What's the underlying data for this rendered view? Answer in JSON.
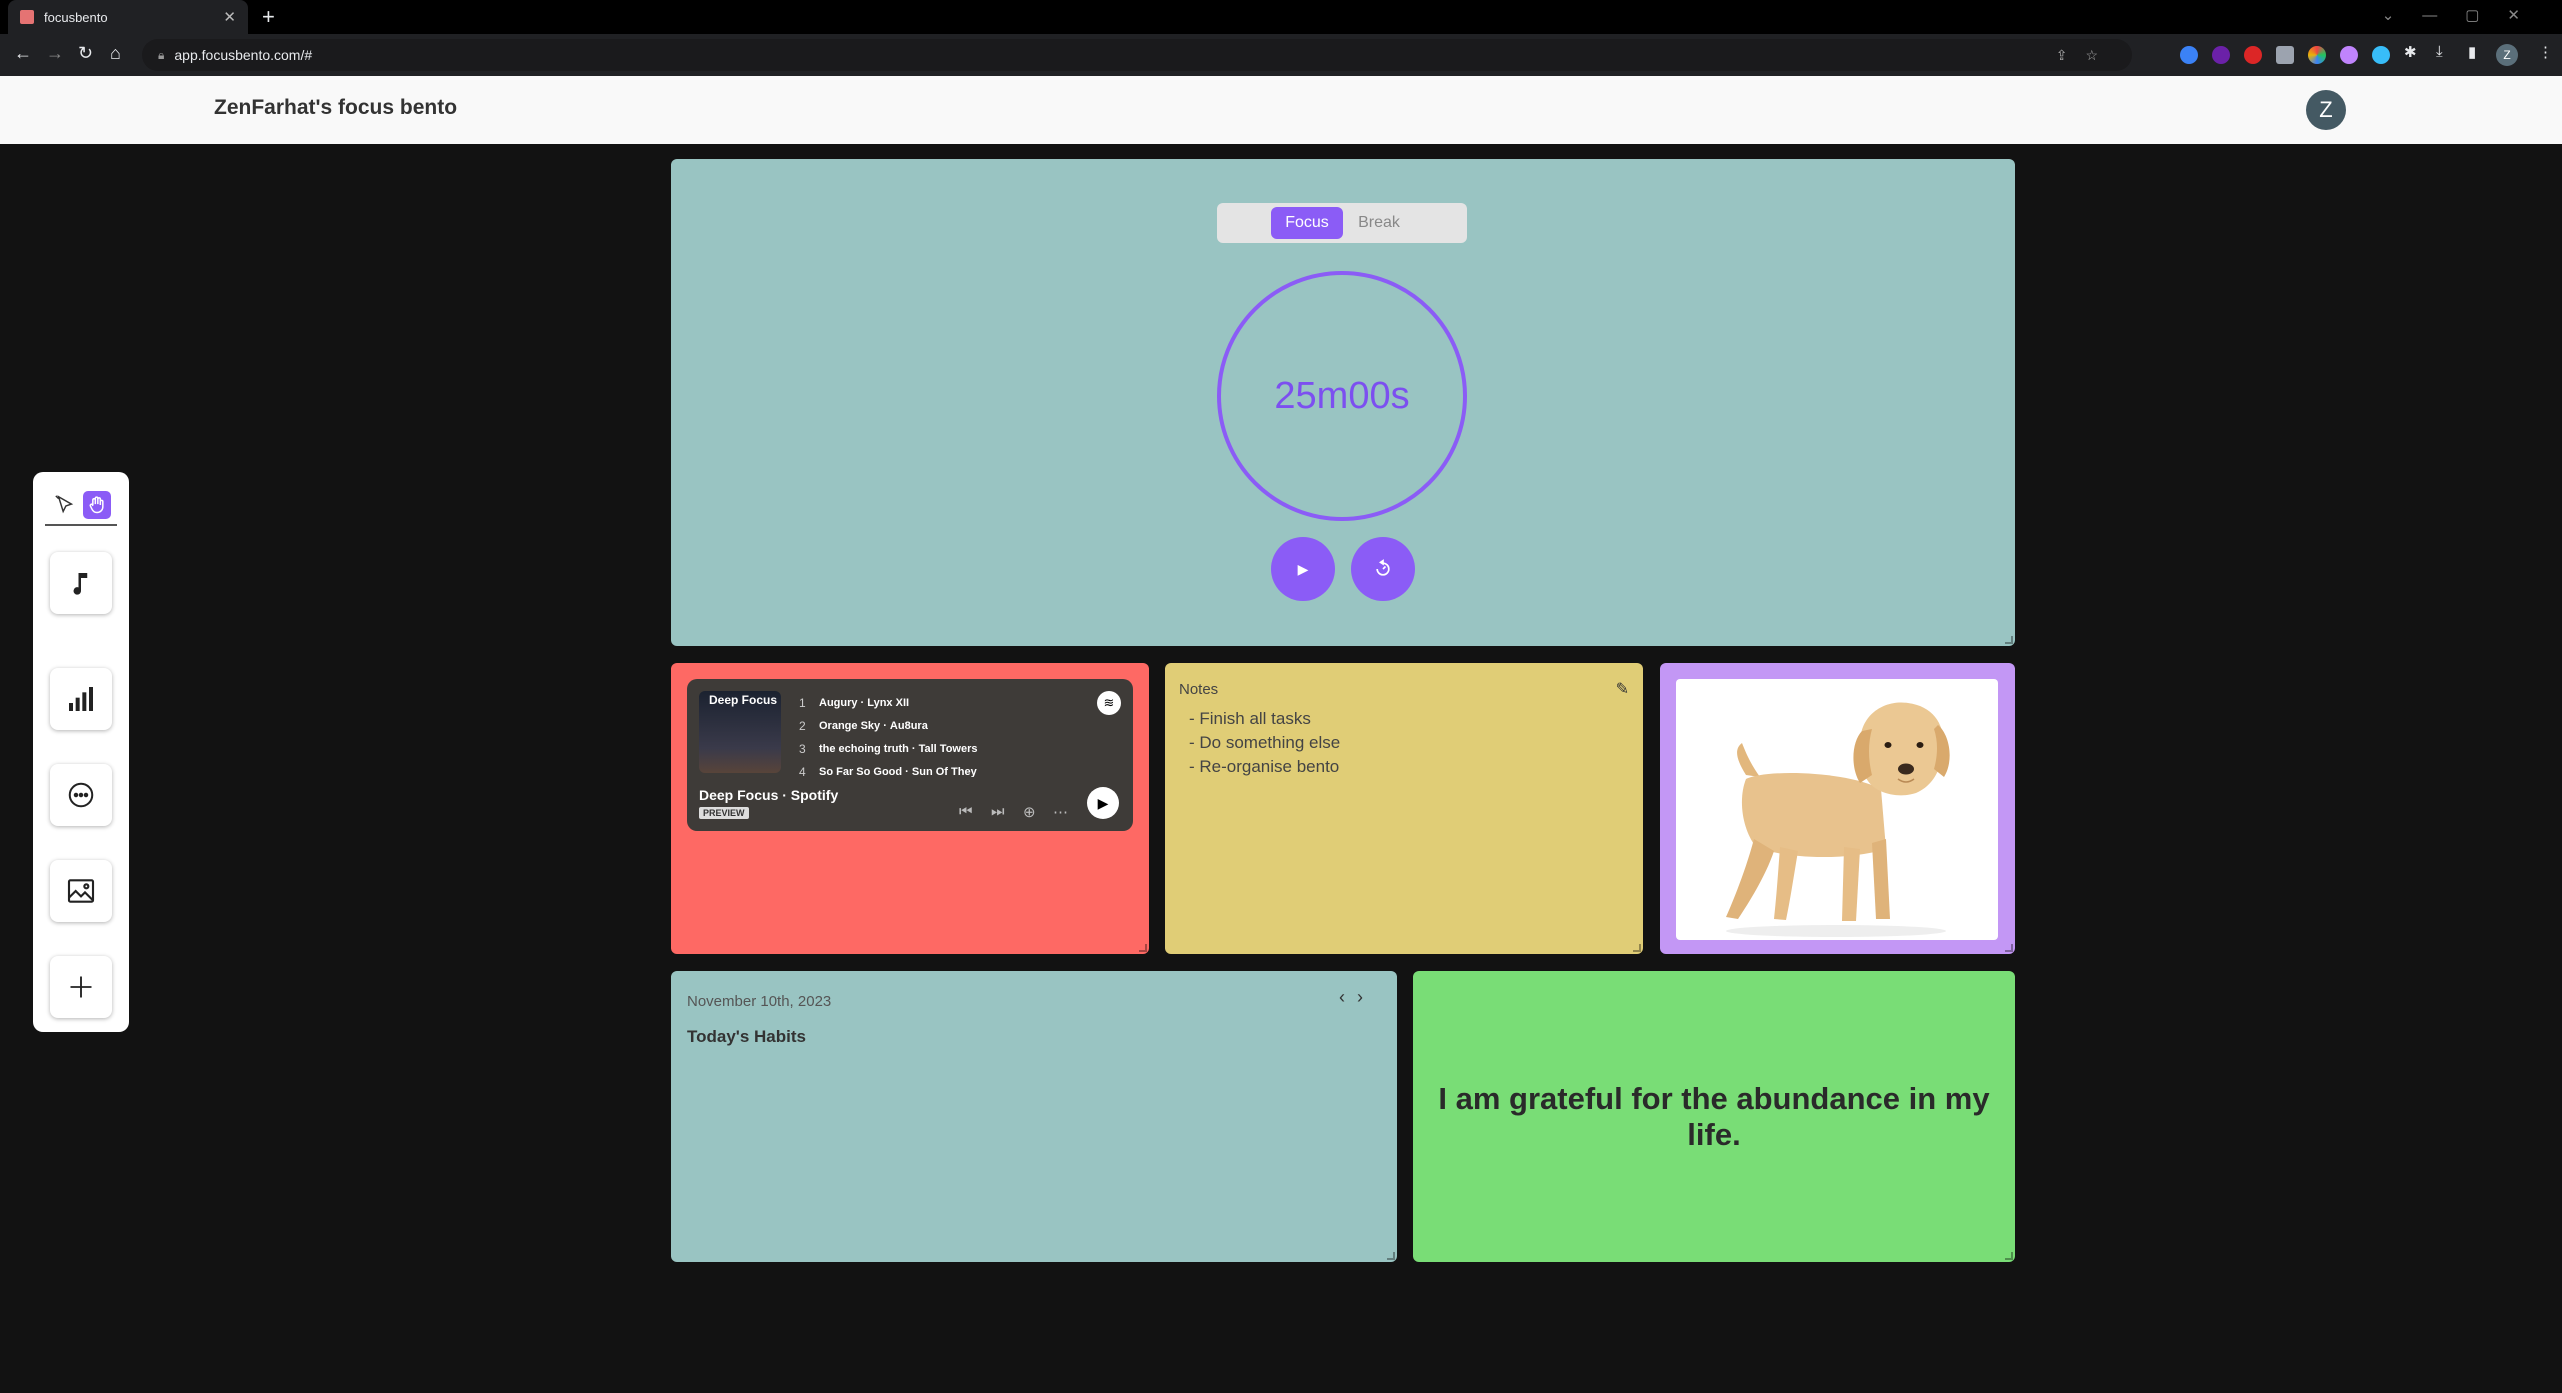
{
  "browser": {
    "tab_title": "focusbento",
    "url": "app.focusbento.com/#",
    "profile_initial": "Z"
  },
  "app": {
    "title": "ZenFarhat's focus bento",
    "avatar_initial": "Z",
    "accent_color": "#8b5cf6"
  },
  "toolbar": {
    "tools": [
      "music-note-icon",
      "chart-icon",
      "chat-bubble-icon",
      "image-icon",
      "plus-icon"
    ]
  },
  "pomodoro": {
    "modes": [
      "Focus",
      "Break"
    ],
    "active_mode": "Focus",
    "time": "25m00s"
  },
  "music": {
    "cover_title": "Deep Focus",
    "tracks": [
      {
        "num": "1",
        "title": "Augury",
        "artist": "Lynx XII"
      },
      {
        "num": "2",
        "title": "Orange Sky",
        "artist": "Au8ura"
      },
      {
        "num": "3",
        "title": "the echoing truth",
        "artist": "Tall Towers"
      },
      {
        "num": "4",
        "title": "So Far So Good",
        "artist": "Sun Of They"
      }
    ],
    "playlist_name": "Deep Focus · Spotify",
    "preview_label": "PREVIEW"
  },
  "notes": {
    "title": "Notes",
    "items": [
      "- Finish all tasks",
      "- Do something else",
      "- Re-organise bento"
    ]
  },
  "habits": {
    "date": "November 10th, 2023",
    "title": "Today's Habits"
  },
  "affirmation": {
    "text": "I am grateful for the abundance in my life."
  }
}
